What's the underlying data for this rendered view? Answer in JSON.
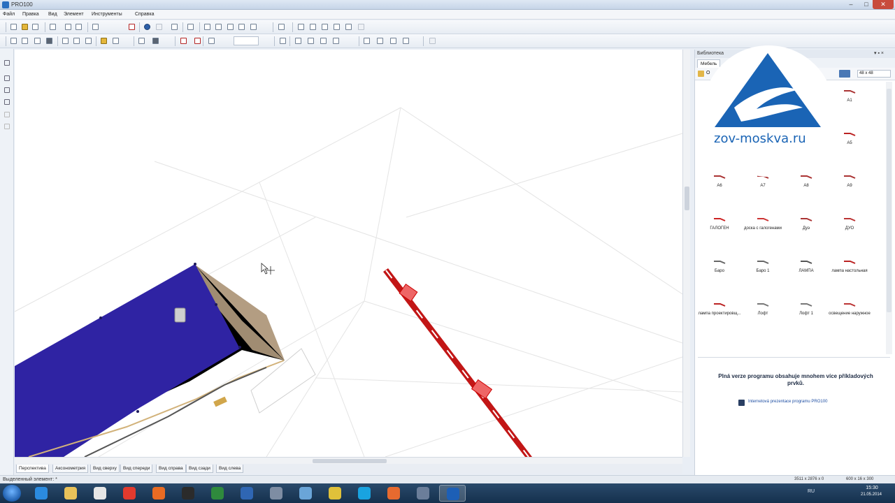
{
  "window": {
    "title": "PRO100",
    "min": "–",
    "max": "□",
    "close": "✕"
  },
  "menu": [
    "Файл",
    "Правка",
    "Вид",
    "Элемент",
    "Инструменты",
    "Справка"
  ],
  "icons": {
    "toolbar1": [
      "new-icon",
      "open-icon",
      "save-icon",
      "print-icon",
      "cut-icon",
      "copy-icon",
      "paste-icon",
      "delete-icon",
      "globe-icon",
      "circle-icon",
      "screenshot-icon",
      "window-icon",
      "align-left-icon",
      "align-right-icon",
      "align-top-icon",
      "align-bottom-icon",
      "align-center-icon",
      "sigma-icon",
      "distribute-h-icon",
      "distribute-v-icon",
      "arrange-icon",
      "group-icon",
      "ungroup-icon",
      "gray-icon"
    ],
    "toolbar2": [
      "rotate-icon",
      "cube-icon",
      "box-icon",
      "wireframe-icon",
      "select-icon",
      "move-icon",
      "paint-icon",
      "light-icon",
      "measure-icon",
      "ruler-icon",
      "texture-icon",
      "magnet-icon",
      "target-icon",
      "zoom-icon",
      "grid-icon",
      "arrow-down-icon",
      "arrow-left-icon",
      "arrow-up-icon",
      "arrow-right-icon",
      "turn-icon",
      "move-all-icon",
      "flip-icon",
      "snap-icon",
      "center-icon"
    ]
  },
  "tabs": [
    "Перспектива",
    "Аксонометрия",
    "Вид сверху",
    "Вид спереди",
    "Вид справа",
    "Вид сзади",
    "Вид слева"
  ],
  "status": {
    "text": "Выделенный элемент: *",
    "coords": "3511 x 2876 x 0",
    "size": "600 x 16 x 300"
  },
  "library": {
    "title": "Библиотека",
    "controls": "▾ ▪ ×",
    "tab": "Мебель",
    "folder_label": "О",
    "size": "48 x 48",
    "items": [
      {
        "label": "A1",
        "color": "#a33"
      },
      {
        "label": "A.",
        "color": "#a33"
      },
      {
        "label": "A5",
        "color": "#b22"
      },
      {
        "label": "A6",
        "color": "#a33"
      },
      {
        "label": "A7",
        "color": "#a33"
      },
      {
        "label": "A8",
        "color": "#a33"
      },
      {
        "label": "A9",
        "color": "#a33"
      },
      {
        "label": "ГАЛОГЕН",
        "color": "#c22"
      },
      {
        "label": "доска с галогенами",
        "color": "#c33"
      },
      {
        "label": "Дуэ",
        "color": "#a33"
      },
      {
        "label": "ДУО",
        "color": "#b33"
      },
      {
        "label": "Баро",
        "color": "#666"
      },
      {
        "label": "Баро 1",
        "color": "#666"
      },
      {
        "label": "ЛАМПА",
        "color": "#555"
      },
      {
        "label": "лампа настольная",
        "color": "#b22"
      },
      {
        "label": "лампа проектировщ...",
        "color": "#b22"
      },
      {
        "label": "Лофт",
        "color": "#777"
      },
      {
        "label": "Лофт 1",
        "color": "#777"
      },
      {
        "label": "освещение наружное",
        "color": "#b33"
      }
    ],
    "info_text": "Plná verze programu obsahuje mnohem více příkladových prvků.",
    "info_link": "Internetová prezentace programu PRO100"
  },
  "watermark": {
    "text": "zov-moskva.ru",
    "color": "#1a64b5"
  },
  "taskbar": {
    "apps": [
      {
        "name": "ie",
        "color": "#2b8be0",
        "active": false
      },
      {
        "name": "explorer",
        "color": "#e9c25a",
        "active": false
      },
      {
        "name": "media",
        "color": "#e6e6e6",
        "active": false
      },
      {
        "name": "yandex",
        "color": "#e23a2e",
        "active": false
      },
      {
        "name": "firefox",
        "color": "#e86b23",
        "active": false
      },
      {
        "name": "app-dark",
        "color": "#2b2b2b",
        "active": false
      },
      {
        "name": "excel",
        "color": "#2f8a3d",
        "active": false
      },
      {
        "name": "word",
        "color": "#2f66b3",
        "active": false
      },
      {
        "name": "tool",
        "color": "#7e8da3",
        "active": false
      },
      {
        "name": "photos",
        "color": "#6aa5d8",
        "active": false
      },
      {
        "name": "chrome",
        "color": "#e0c13a",
        "active": false
      },
      {
        "name": "skype",
        "color": "#19a3e0",
        "active": false
      },
      {
        "name": "paint",
        "color": "#e76a2f",
        "active": false
      },
      {
        "name": "remote",
        "color": "#6b7e9a",
        "active": false
      },
      {
        "name": "pro100",
        "color": "#1d5fb6",
        "active": true
      }
    ],
    "lang": "RU",
    "time": "15:30",
    "date": "21.05.2014"
  }
}
